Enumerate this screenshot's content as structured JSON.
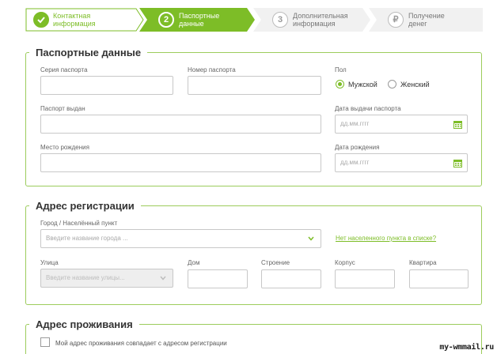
{
  "stepper": {
    "steps": [
      {
        "number": "",
        "label1": "Контактная",
        "label2": "информация",
        "state": "done"
      },
      {
        "number": "2",
        "label1": "Паспортные",
        "label2": "данные",
        "state": "active"
      },
      {
        "number": "3",
        "label1": "Дополнительная",
        "label2": "информация",
        "state": "pending"
      },
      {
        "number": "₽",
        "label1": "Получение",
        "label2": "денег",
        "state": "pending"
      }
    ]
  },
  "passport": {
    "title": "Паспортные данные",
    "series_label": "Серия паспорта",
    "number_label": "Номер паспорта",
    "gender_label": "Пол",
    "gender_options": [
      "Мужской",
      "Женский"
    ],
    "gender_selected": "Мужской",
    "issued_by_label": "Паспорт выдан",
    "issue_date_label": "Дата выдачи паспорта",
    "issue_date_placeholder": "дд.мм.гггг",
    "birthplace_label": "Место рождения",
    "birthdate_label": "Дата рождения",
    "birthdate_placeholder": "дд.мм.гггг"
  },
  "registration": {
    "title": "Адрес регистрации",
    "city_label": "Город / Населённый пункт",
    "city_placeholder": "Введите название города ...",
    "city_missing_link": "Нет населенного пункта в списке?",
    "street_label": "Улица",
    "street_placeholder": "Введите название улицы...",
    "house_label": "Дом",
    "building_label": "Строение",
    "block_label": "Корпус",
    "apartment_label": "Квартира"
  },
  "residence": {
    "title": "Адрес проживания",
    "same_address_label": "Мой адрес проживания совпадает с адресом регистрации"
  },
  "watermark": "my-wmmail.ru",
  "colors": {
    "accent": "#7dbd27",
    "border": "#9ccc5c",
    "input_border": "#c8c8c8",
    "step_inactive": "#f1f1f1"
  }
}
